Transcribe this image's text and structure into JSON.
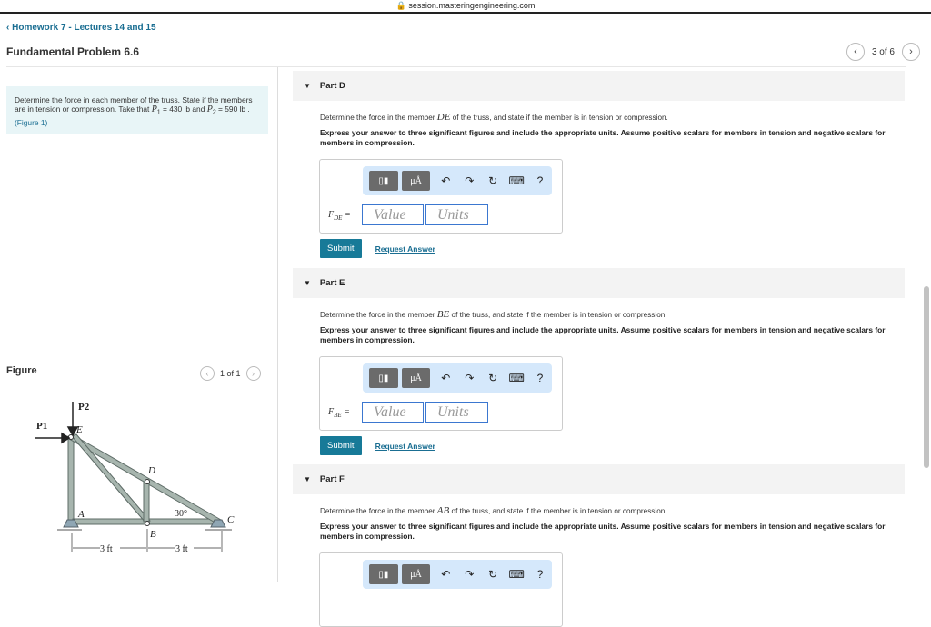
{
  "browser": {
    "url": "session.masteringengineering.com"
  },
  "nav": {
    "back": "Homework 7 - Lectures 14 and 15",
    "title": "Fundamental Problem 6.6",
    "pager": "3 of 6"
  },
  "intro": {
    "text1": "Determine the force in each member of the truss. State if the members are in tension or compression. Take that ",
    "p1": "P",
    "p1_sub": "1",
    "p1_val": " = 430 lb",
    "and": " and ",
    "p2": "P",
    "p2_sub": "2",
    "p2_val": " = 590 lb",
    "link": "(Figure 1)"
  },
  "figure": {
    "label": "Figure",
    "pager": "1 of 1",
    "labels": {
      "p1": "P1",
      "p2": "P2",
      "e": "E",
      "d": "D",
      "a": "A",
      "b": "B",
      "c": "C",
      "angle": "30°",
      "dim1": "3 ft",
      "dim2": "3 ft"
    }
  },
  "toolbar": {
    "templates": "▯▮",
    "units": "μÅ",
    "undo": "↶",
    "redo": "↷",
    "reset": "↻",
    "keyboard": "⌨",
    "help": "?"
  },
  "parts": [
    {
      "title": "Part D",
      "q_pre": "Determine the force in the member ",
      "member": "DE",
      "q_post": " of the truss, and state if the member is in tension or compression.",
      "express": "Express your answer to three significant figures and include the appropriate units. Assume positive scalars for members in tension and negative scalars for members in compression.",
      "label": "F",
      "label_sub": "DE",
      "label_eq": " =",
      "value_ph": "Value",
      "units_ph": "Units",
      "submit": "Submit",
      "request": "Request Answer"
    },
    {
      "title": "Part E",
      "q_pre": "Determine the force in the member ",
      "member": "BE",
      "q_post": " of the truss, and state if the member is in tension or compression.",
      "express": "Express your answer to three significant figures and include the appropriate units. Assume positive scalars for members in tension and negative scalars for members in compression.",
      "label": "F",
      "label_sub": "BE",
      "label_eq": " =",
      "value_ph": "Value",
      "units_ph": "Units",
      "submit": "Submit",
      "request": "Request Answer"
    },
    {
      "title": "Part F",
      "q_pre": "Determine the force in the member ",
      "member": "AB",
      "q_post": " of the truss, and state if the member is in tension or compression.",
      "express": "Express your answer to three significant figures and include the appropriate units. Assume positive scalars for members in tension and negative scalars for members in compression."
    }
  ]
}
